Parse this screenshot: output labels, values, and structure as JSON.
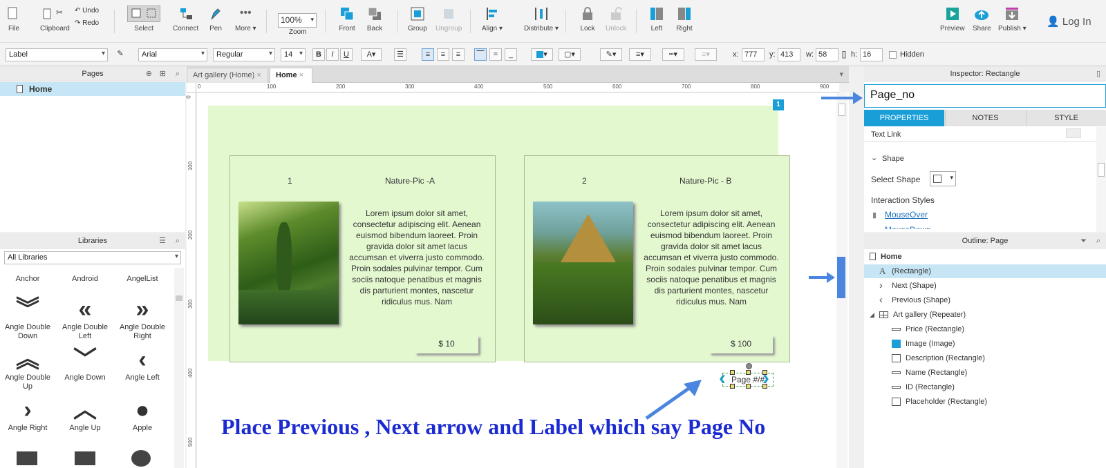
{
  "toolbar": {
    "file": "File",
    "clipboard": "Clipboard",
    "undo": "Undo",
    "redo": "Redo",
    "select": "Select",
    "connect": "Connect",
    "pen": "Pen",
    "more": "More ▾",
    "zoom_value": "100%",
    "zoom": "Zoom",
    "front": "Front",
    "back": "Back",
    "group": "Group",
    "ungroup": "Ungroup",
    "align": "Align ▾",
    "distribute": "Distribute ▾",
    "lock": "Lock",
    "unlock": "Unlock",
    "left": "Left",
    "right": "Right",
    "preview": "Preview",
    "share": "Share",
    "publish": "Publish ▾",
    "login": "Log In"
  },
  "format": {
    "style": "Label",
    "font": "Arial",
    "weight": "Regular",
    "size": "14",
    "x_label": "x:",
    "x": "777",
    "y_label": "y:",
    "y": "413",
    "w_label": "w:",
    "w": "58",
    "h_label": "h:",
    "h": "16",
    "hidden": "Hidden"
  },
  "pages": {
    "title": "Pages",
    "items": [
      "Home"
    ]
  },
  "libraries": {
    "title": "Libraries",
    "selected": "All Libraries",
    "items": [
      {
        "label": "Anchor",
        "icon": "anchor-icon"
      },
      {
        "label": "Android",
        "icon": "android-icon"
      },
      {
        "label": "AngelList",
        "icon": "angellist-icon"
      },
      {
        "label": "Angle Double Down",
        "icon": "angle-double-down-icon",
        "glyph": "︾"
      },
      {
        "label": "Angle Double Left",
        "icon": "angle-double-left-icon",
        "glyph": "«"
      },
      {
        "label": "Angle Double Right",
        "icon": "angle-double-right-icon",
        "glyph": "»"
      },
      {
        "label": "Angle Double Up",
        "icon": "angle-double-up-icon",
        "glyph": "︽"
      },
      {
        "label": "Angle Down",
        "icon": "angle-down-icon",
        "glyph": "﹀"
      },
      {
        "label": "Angle Left",
        "icon": "angle-left-icon",
        "glyph": "‹"
      },
      {
        "label": "Angle Right",
        "icon": "angle-right-icon",
        "glyph": "›"
      },
      {
        "label": "Angle Up",
        "icon": "angle-up-icon",
        "glyph": "︿"
      },
      {
        "label": "Apple",
        "icon": "apple-icon",
        "glyph": "●"
      }
    ]
  },
  "tabs": [
    {
      "label": "Art gallery (Home)"
    },
    {
      "label": "Home"
    }
  ],
  "ruler": {
    "h": [
      "0",
      "100",
      "200",
      "300",
      "400",
      "500",
      "600",
      "700",
      "800",
      "900"
    ],
    "v": [
      "0",
      "100",
      "200",
      "300",
      "400",
      "500"
    ]
  },
  "canvas": {
    "badge": "1",
    "cards": [
      {
        "id": "1",
        "name": "Nature-Pic -A",
        "price": "$ 10",
        "desc": "Lorem ipsum dolor sit amet, consectetur adipiscing elit. Aenean euismod bibendum laoreet. Proin gravida dolor sit amet lacus accumsan et viverra justo commodo. Proin sodales pulvinar tempor. Cum sociis natoque penatibus et magnis dis parturient montes, nascetur ridiculus mus. Nam"
      },
      {
        "id": "2",
        "name": "Nature-Pic - B",
        "price": "$ 100",
        "desc": "Lorem ipsum dolor sit amet, consectetur adipiscing elit. Aenean euismod bibendum laoreet. Proin gravida dolor sit amet lacus accumsan et viverra justo commodo. Proin sodales pulvinar tempor. Cum sociis natoque penatibus et magnis dis parturient montes, nascetur ridiculus mus. Nam"
      }
    ],
    "page_label": "Page #/#",
    "annotation": "Place Previous , Next arrow and Label which say Page No"
  },
  "inspector": {
    "title": "Inspector: Rectangle",
    "name_value": "Page_no",
    "tabs": [
      "PROPERTIES",
      "NOTES",
      "STYLE"
    ],
    "text_link": "Text Link",
    "shape_section": "Shape",
    "select_shape": "Select Shape",
    "interaction_styles": "Interaction Styles",
    "mouseover": "MouseOver",
    "mousedown": "MouseDown"
  },
  "outline": {
    "title": "Outline: Page",
    "items": [
      {
        "label": "Home",
        "icon": "page-icon"
      },
      {
        "label": "(Rectangle)",
        "icon": "text-icon"
      },
      {
        "label": "Next (Shape)",
        "icon": "chevron-right-icon"
      },
      {
        "label": "Previous (Shape)",
        "icon": "chevron-left-icon"
      },
      {
        "label": "Art gallery (Repeater)",
        "icon": "repeater-icon"
      },
      {
        "label": "Price (Rectangle)",
        "icon": "rectangle-icon"
      },
      {
        "label": "Image  (Image)",
        "icon": "image-icon"
      },
      {
        "label": "Description  (Rectangle)",
        "icon": "rectangle-icon"
      },
      {
        "label": "Name  (Rectangle)",
        "icon": "rectangle-icon"
      },
      {
        "label": "ID (Rectangle)",
        "icon": "rectangle-icon"
      },
      {
        "label": "Placeholder (Rectangle)",
        "icon": "rectangle-icon"
      }
    ]
  },
  "colors": {
    "accent": "#1a9ed8",
    "annotation": "#1b2bd1",
    "arrow": "#4a86e0",
    "card": "#e4f8d0"
  }
}
